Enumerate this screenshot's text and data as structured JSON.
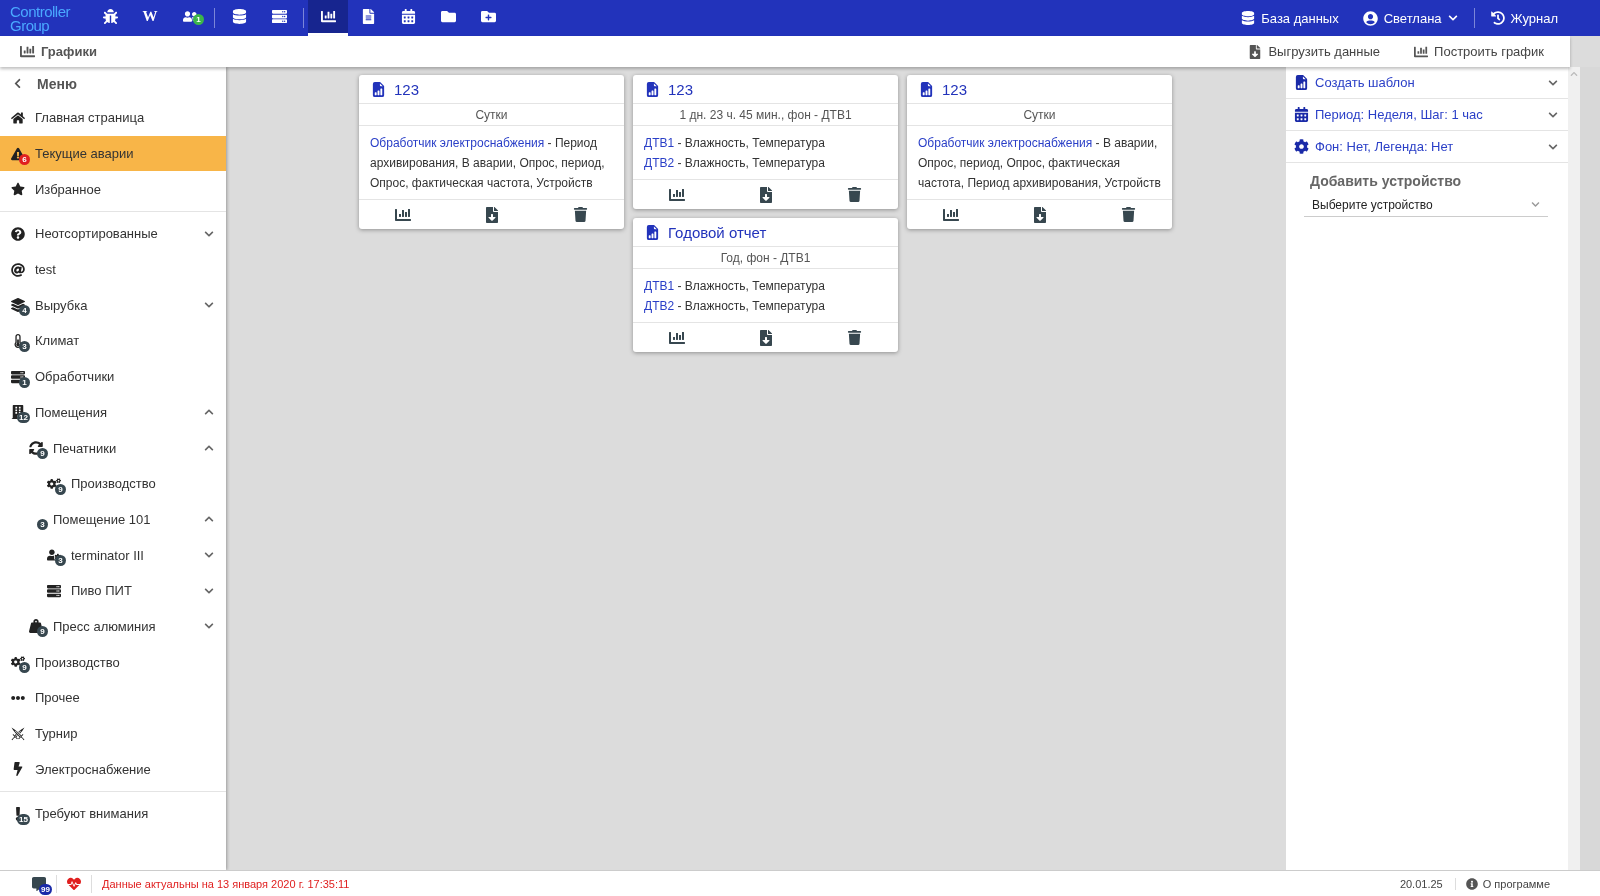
{
  "topbar": {
    "logo": "Controller Group",
    "tools": [
      {
        "selected": false
      },
      {
        "label": "W",
        "selected": false
      },
      {
        "badge": "1",
        "selected": false
      },
      {
        "selected": false
      },
      {
        "selected": false
      },
      {
        "selected": true
      },
      {
        "selected": false
      },
      {
        "selected": false
      },
      {
        "selected": false
      },
      {
        "selected": false
      }
    ],
    "database": "База данных",
    "user": "Светлана",
    "journal": "Журнал"
  },
  "subbar": {
    "title": "Графики",
    "actions": [
      "Выгрузить данные",
      "Построить график"
    ]
  },
  "sidebar": {
    "back": "Меню",
    "sections": [
      {
        "items": [
          {
            "label": "Главная страница",
            "selected": false
          },
          {
            "label": "Текущие аварии",
            "badge": "6",
            "color": "#e02020",
            "selected": true
          },
          {
            "label": "Избранное",
            "selected": false
          }
        ]
      },
      {
        "items": [
          {
            "label": "Неотсортированные",
            "selected": false,
            "expanded": false
          },
          {
            "label": "test",
            "selected": false
          },
          {
            "label": "Вырубка",
            "badge": "4",
            "color": "#37474f",
            "selected": false,
            "expanded": false
          },
          {
            "label": "Климат",
            "badge": "3",
            "color": "#37474f",
            "selected": false
          },
          {
            "label": "Обработчики",
            "badge": "1",
            "color": "#37474f",
            "selected": false
          },
          {
            "label": "Помещения",
            "badge": "12",
            "color": "#37474f",
            "selected": false,
            "expanded": true,
            "children": [
              {
                "label": "Печатники",
                "badge": "9",
                "color": "#37474f",
                "selected": false,
                "expanded": true,
                "children": [
                  {
                    "label": "Производство",
                    "badge": "9",
                    "color": "#37474f",
                    "selected": false
                  }
                ]
              },
              {
                "label": "Помещение 101",
                "badge": "3",
                "color": "#37474f",
                "selected": false,
                "expanded": true,
                "children": [
                  {
                    "label": "terminator III",
                    "badge": "3",
                    "color": "#37474f",
                    "selected": false,
                    "expanded": false
                  },
                  {
                    "label": "Пиво ПИТ",
                    "selected": false,
                    "expanded": false
                  }
                ]
              },
              {
                "label": "Пресс алюминия",
                "badge": "9",
                "color": "#37474f",
                "selected": false,
                "expanded": false
              }
            ]
          },
          {
            "label": "Производство",
            "badge": "9",
            "color": "#37474f",
            "selected": false
          },
          {
            "label": "Прочее",
            "selected": false
          },
          {
            "label": "Турнир",
            "selected": false
          },
          {
            "label": "Электроснабжение",
            "selected": false
          }
        ]
      },
      {
        "items": [
          {
            "label": "Требуют внимания",
            "badge": "15",
            "color": "#37474f",
            "selected": false
          }
        ]
      }
    ]
  },
  "cards": [
    {
      "title": "123",
      "subtitle": "Сутки",
      "entries": [
        {
          "link": "Обработчик электроснабжения",
          "text": " - Период архивирования, В аварии, Опрос, период, Опрос, фактическая частота, Устройств"
        }
      ]
    },
    {
      "title": "123",
      "subtitle": "1 дн. 23 ч. 45 мин., фон - ДТВ1",
      "entries": [
        {
          "link": "ДТВ1",
          "text": " - Влажность, Температура"
        },
        {
          "link": "ДТВ2",
          "text": " - Влажность, Температура"
        }
      ]
    },
    {
      "title": "123",
      "subtitle": "Сутки",
      "entries": [
        {
          "link": "Обработчик электроснабжения",
          "text": " - В аварии, Опрос, период, Опрос, фактическая частота, Период архивирования, Устройств"
        }
      ]
    },
    {
      "title": "Годовой отчет",
      "subtitle": "Год, фон - ДТВ1",
      "entries": [
        {
          "link": "ДТВ1",
          "text": " - Влажность, Температура"
        },
        {
          "link": "ДТВ2",
          "text": " - Влажность, Температура"
        }
      ]
    }
  ],
  "panel": {
    "sections": [
      {
        "label": "Создать шаблон",
        "expanded": false
      },
      {
        "label": "Период: Неделя, Шаг: 1 час",
        "expanded": false
      },
      {
        "label": "Фон: Нет, Легенда: Нет",
        "expanded": false
      }
    ],
    "add_device": {
      "title": "Добавить устройство",
      "placeholder": "Выберите устройство"
    }
  },
  "status_bar": {
    "messages_badge": "99",
    "status": "Данные актуальны на 13 января 2020 г. 17:35:11",
    "date": "20.01.25",
    "about": "О программе"
  }
}
